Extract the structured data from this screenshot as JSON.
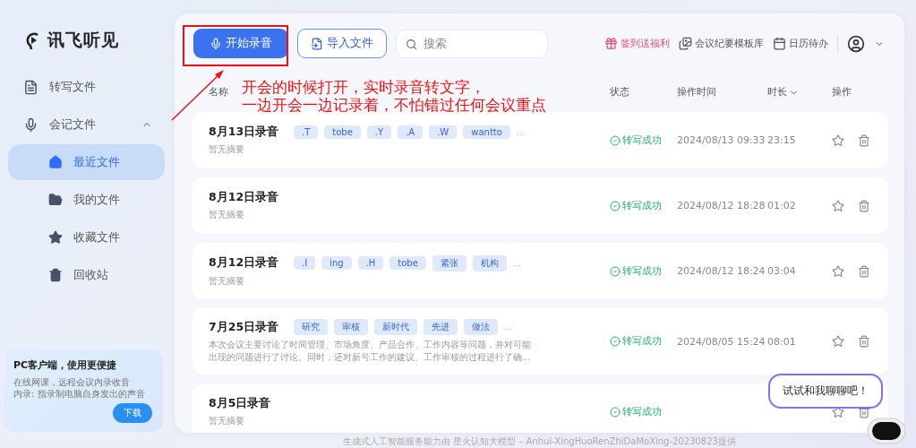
{
  "app": {
    "logo": "讯飞听见"
  },
  "sidebar": {
    "items": [
      {
        "label": "转写文件",
        "selected": false
      },
      {
        "label": "会记文件",
        "expanded": true,
        "children": [
          {
            "label": "最近文件",
            "selected": true
          },
          {
            "label": "我的文件",
            "selected": false
          },
          {
            "label": "收藏文件",
            "selected": false
          },
          {
            "label": "回收站",
            "selected": false
          }
        ]
      }
    ]
  },
  "promo": {
    "title": "PC客户端，使用更便捷",
    "lines": [
      "在线网课，远程会议内录收音",
      "内录: 指录制电脑自身发出的声音"
    ],
    "button": "下载"
  },
  "toolbar": {
    "record_button": "开始录音",
    "import_button": "导入文件",
    "search": {
      "placeholder": "搜索"
    },
    "links": [
      {
        "label": "签到送福利",
        "kind": "promo"
      },
      {
        "label": "会议纪要模板库",
        "kind": "plain"
      },
      {
        "label": "日历待办",
        "kind": "plain"
      }
    ]
  },
  "table": {
    "columns": [
      {
        "label": "名称",
        "sortable": false
      },
      {
        "label": "状态",
        "sortable": false
      },
      {
        "label": "操作时间",
        "sortable": false
      },
      {
        "label": "时长",
        "sortable": true
      },
      {
        "label": "操作",
        "sortable": false
      }
    ],
    "rows": [
      {
        "title": "8月13日录音",
        "tags": [
          ".T",
          "tobe",
          ".Y",
          ".A",
          ".W",
          "wantto"
        ],
        "more": "...",
        "summary": "暂无摘要",
        "status": "转写成功",
        "time": "2024/08/13 09:33",
        "duration": "23:15",
        "starred": false
      },
      {
        "title": "8月12日录音",
        "tags": [],
        "summary": "暂无摘要",
        "status": "转写成功",
        "time": "2024/08/12 18:28",
        "duration": "01:02",
        "starred": false
      },
      {
        "title": "8月12日录音",
        "tags": [
          ".I",
          "ing",
          ".H",
          "tobe",
          "紧张",
          "机构"
        ],
        "more": "...",
        "summary": "暂无摘要",
        "status": "转写成功",
        "time": "2024/08/12 18:24",
        "duration": "03:04",
        "starred": false
      },
      {
        "title": "7月25日录音",
        "tags": [
          "研究",
          "审核",
          "新时代",
          "先进",
          "做法"
        ],
        "more": "...",
        "summary": "本次会议主要讨论了时间管理、市场角度、产品合作、工作内容等问题，并对可能出现的问题进行了讨论。同时，还对新号工作的建议、工作审核的过程进行了确...",
        "status": "转写成功",
        "time": "2024/08/05 15:24",
        "duration": "08:01",
        "starred": false
      },
      {
        "title": "8月5日录音",
        "tags": [],
        "summary": "暂无摘要",
        "status": "转写成功",
        "starred": false
      }
    ]
  },
  "annotation": {
    "lines": [
      "开会的时候打开，实时录音转文字，",
      "一边开会一边记录着，不怕错过任何会议重点"
    ]
  },
  "chat_bubble": "试试和我聊聊吧！",
  "footer": "生成式人工智能服务能力由 星火认知大模型 – Anhui-XingHuoRenZhiDaMoXing-20230823提供"
}
